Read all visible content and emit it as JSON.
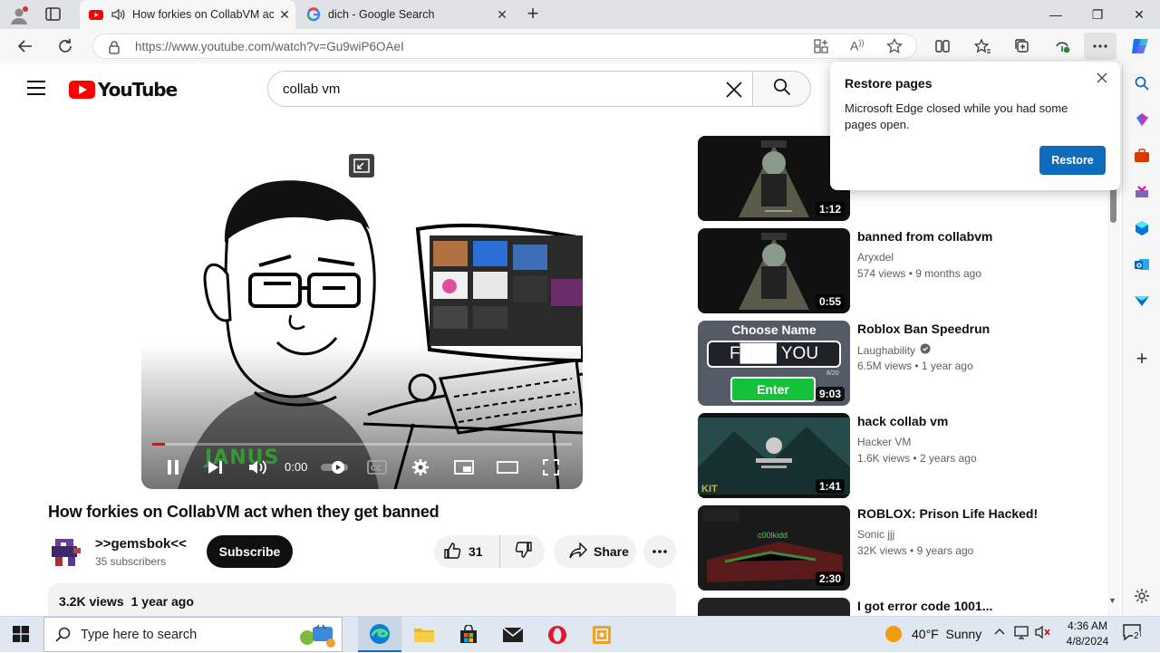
{
  "browser": {
    "tabs": [
      {
        "title": "How forkies on CollabVM act when they get banned",
        "active": true
      },
      {
        "title": "dich - Google Search",
        "active": false
      }
    ],
    "url": "https://www.youtube.com/watch?v=Gu9wiP6OAeI"
  },
  "youtube": {
    "logo_text": "YouTube",
    "search_query": "collab vm"
  },
  "player": {
    "time": "0:00",
    "progress": 0.03,
    "overlay_logo_text": "JANUS"
  },
  "video": {
    "title": "How forkies on CollabVM act when they get banned",
    "channel": ">>gemsbok<<",
    "subscribers": "35 subscribers",
    "subscribe_label": "Subscribe",
    "likes": "31",
    "share_label": "Share",
    "views": "3.2K views",
    "age": "1 year ago"
  },
  "recommendations": [
    {
      "title": "",
      "channel": "",
      "views": "",
      "age": "",
      "duration": "1:12",
      "verified": false
    },
    {
      "title": "banned from collabvm",
      "channel": "Aryxdel",
      "views": "574 views",
      "age": "9 months ago",
      "duration": "0:55",
      "verified": false
    },
    {
      "title": "Roblox Ban Speedrun",
      "channel": "Laughability",
      "views": "6.5M views",
      "age": "1 year ago",
      "duration": "9:03",
      "verified": true
    },
    {
      "title": "hack collab vm",
      "channel": "Hacker VM",
      "views": "1.6K views",
      "age": "2 years ago",
      "duration": "1:41",
      "verified": false
    },
    {
      "title": "ROBLOX: Prison Life Hacked!",
      "channel": "Sonic jjj",
      "views": "32K views",
      "age": "9 years ago",
      "duration": "2:30",
      "verified": false
    },
    {
      "title": "I got error code 1001...",
      "channel": "",
      "views": "",
      "age": "",
      "duration": "",
      "verified": false
    }
  ],
  "thumb_text": {
    "roblox_choose": "Choose Name",
    "roblox_name": "F███ YOU",
    "roblox_enter": "Enter",
    "roblox_counter": "8/20",
    "hack_kit": "KIT",
    "prison_name": "c00lkidd"
  },
  "restore_popup": {
    "heading": "Restore pages",
    "body": "Microsoft Edge closed while you had some pages open.",
    "button": "Restore"
  },
  "taskbar": {
    "search_placeholder": "Type here to search",
    "weather": "40°F  Sunny",
    "time": "4:36 AM",
    "date": "4/8/2024",
    "notification_count": "2"
  },
  "colors": {
    "accent_red": "#ff0000",
    "edge_blue": "#0f6cbd"
  }
}
